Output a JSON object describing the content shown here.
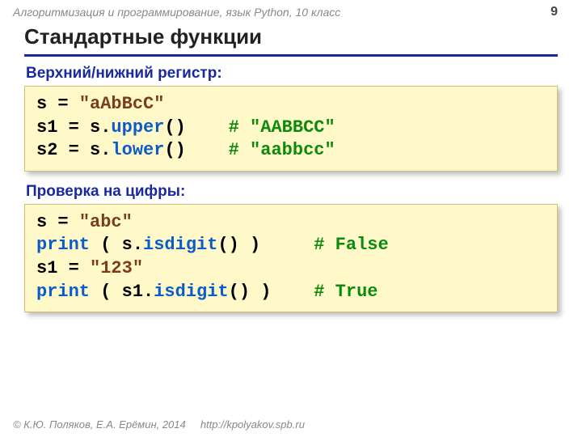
{
  "header": {
    "course": "Алгоритмизация и программирование, язык Python, 10 класс",
    "page": "9"
  },
  "title": "Стандартные функции",
  "section1": {
    "label": "Верхний/нижний регистр:"
  },
  "code1": {
    "l1_a": "s",
    "l1_b": "=",
    "l1_c": "\"aAbBcC\"",
    "l2_a": "s1",
    "l2_b": "=",
    "l2_c": "s",
    "l2_d": ".",
    "l2_e": "upper",
    "l2_f": "()",
    "l2_com": "# \"AABBCC\"",
    "l3_a": "s2",
    "l3_b": "=",
    "l3_c": "s",
    "l3_d": ".",
    "l3_e": "lower",
    "l3_f": "()",
    "l3_com": "# \"aabbcc\""
  },
  "section2": {
    "label": "Проверка на цифры:"
  },
  "code2": {
    "l1_a": "s",
    "l1_b": "=",
    "l1_c": "\"abc\"",
    "l2_a": "print",
    "l2_b": "(  s",
    "l2_c": ".",
    "l2_d": "isdigit",
    "l2_e": "()",
    "l2_f": " )",
    "l2_com": "# False",
    "l3_a": "s1",
    "l3_b": "=",
    "l3_c": "\"123\"",
    "l4_a": "print",
    "l4_b": "( s1",
    "l4_c": ".",
    "l4_d": "isdigit",
    "l4_e": "()",
    "l4_f": " )",
    "l4_com": "# True"
  },
  "footer": {
    "copyright": "© К.Ю. Поляков, Е.А. Ерёмин, 2014",
    "url": "http://kpolyakov.spb.ru"
  }
}
